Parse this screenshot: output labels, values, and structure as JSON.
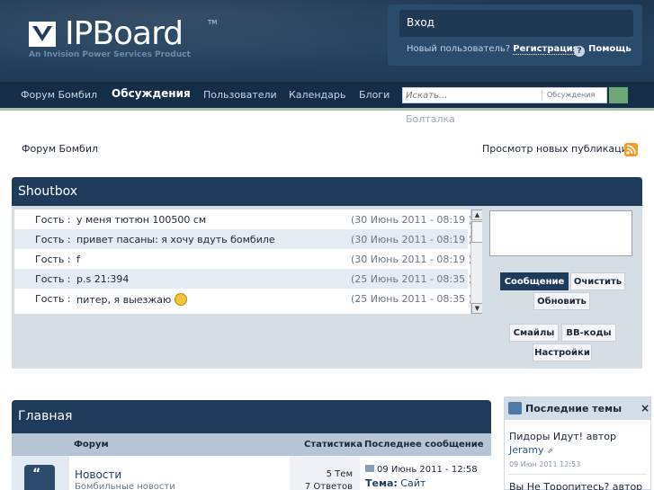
{
  "header": {
    "logo_text": "IPBoard",
    "logo_tm": "TM",
    "logo_sub": "An Invision Power Services Product",
    "sign_in": "Вход",
    "new_user": "Новый пользователь?",
    "register": "Регистрация",
    "help": "Помощь"
  },
  "nav": {
    "items": [
      "Форум Бомбил",
      "Обсуждения",
      "Пользователи",
      "Календарь",
      "Блоги"
    ],
    "active": "Обсуждения",
    "search_placeholder": "Искать...",
    "search_scope": "Обсуждения",
    "sub_item": "Болталка"
  },
  "breadcrumb": "Форум Бомбил",
  "new_posts": "Просмотр новых публикаций",
  "shoutbox": {
    "title": "Shoutbox",
    "rows": [
      {
        "name": "Гость :",
        "msg": "у меня тютюн 100500 см",
        "time": "(30 Июнь 2011 - 08:19 )"
      },
      {
        "name": "Гость :",
        "msg": "привет пасаны: я хочу вдуть бомбиле",
        "time": "(30 Июнь 2011 - 08:19 )"
      },
      {
        "name": "Гость :",
        "msg": "f",
        "time": "(30 Июнь 2011 - 08:19 )"
      },
      {
        "name": "Гость :",
        "msg": "p.s 21:394",
        "time": "(25 Июнь 2011 - 08:35 )"
      },
      {
        "name": "Гость :",
        "msg": "питер, я выезжаю",
        "time": "(25 Июнь 2011 - 08:35 )"
      }
    ],
    "buttons": {
      "message": "Сообщение",
      "clear": "Очистить",
      "refresh": "Обновить",
      "smilies": "Смайлы",
      "bbcodes": "BB-коды",
      "settings": "Настройки"
    }
  },
  "forum": {
    "title": "Главная",
    "columns": {
      "forum": "Форум",
      "stats": "Статистика",
      "last": "Последнее сообщение"
    },
    "row": {
      "name": "Новости",
      "desc": "Бомбильные новости",
      "topics": "5 Тем",
      "replies": "7 Ответов",
      "last_date": "09 Июнь 2011 - 12:58",
      "last_topic_label": "Тема:",
      "last_topic": "Сайт"
    }
  },
  "latest": {
    "title": "Последние темы",
    "items": [
      {
        "title": "Пидоры Идут! автор",
        "author": "Jeramy",
        "date": "09 Июн 2011 12:53"
      },
      {
        "title": "Вы Не Торопитесь? автор",
        "author": "",
        "date": ""
      }
    ]
  }
}
